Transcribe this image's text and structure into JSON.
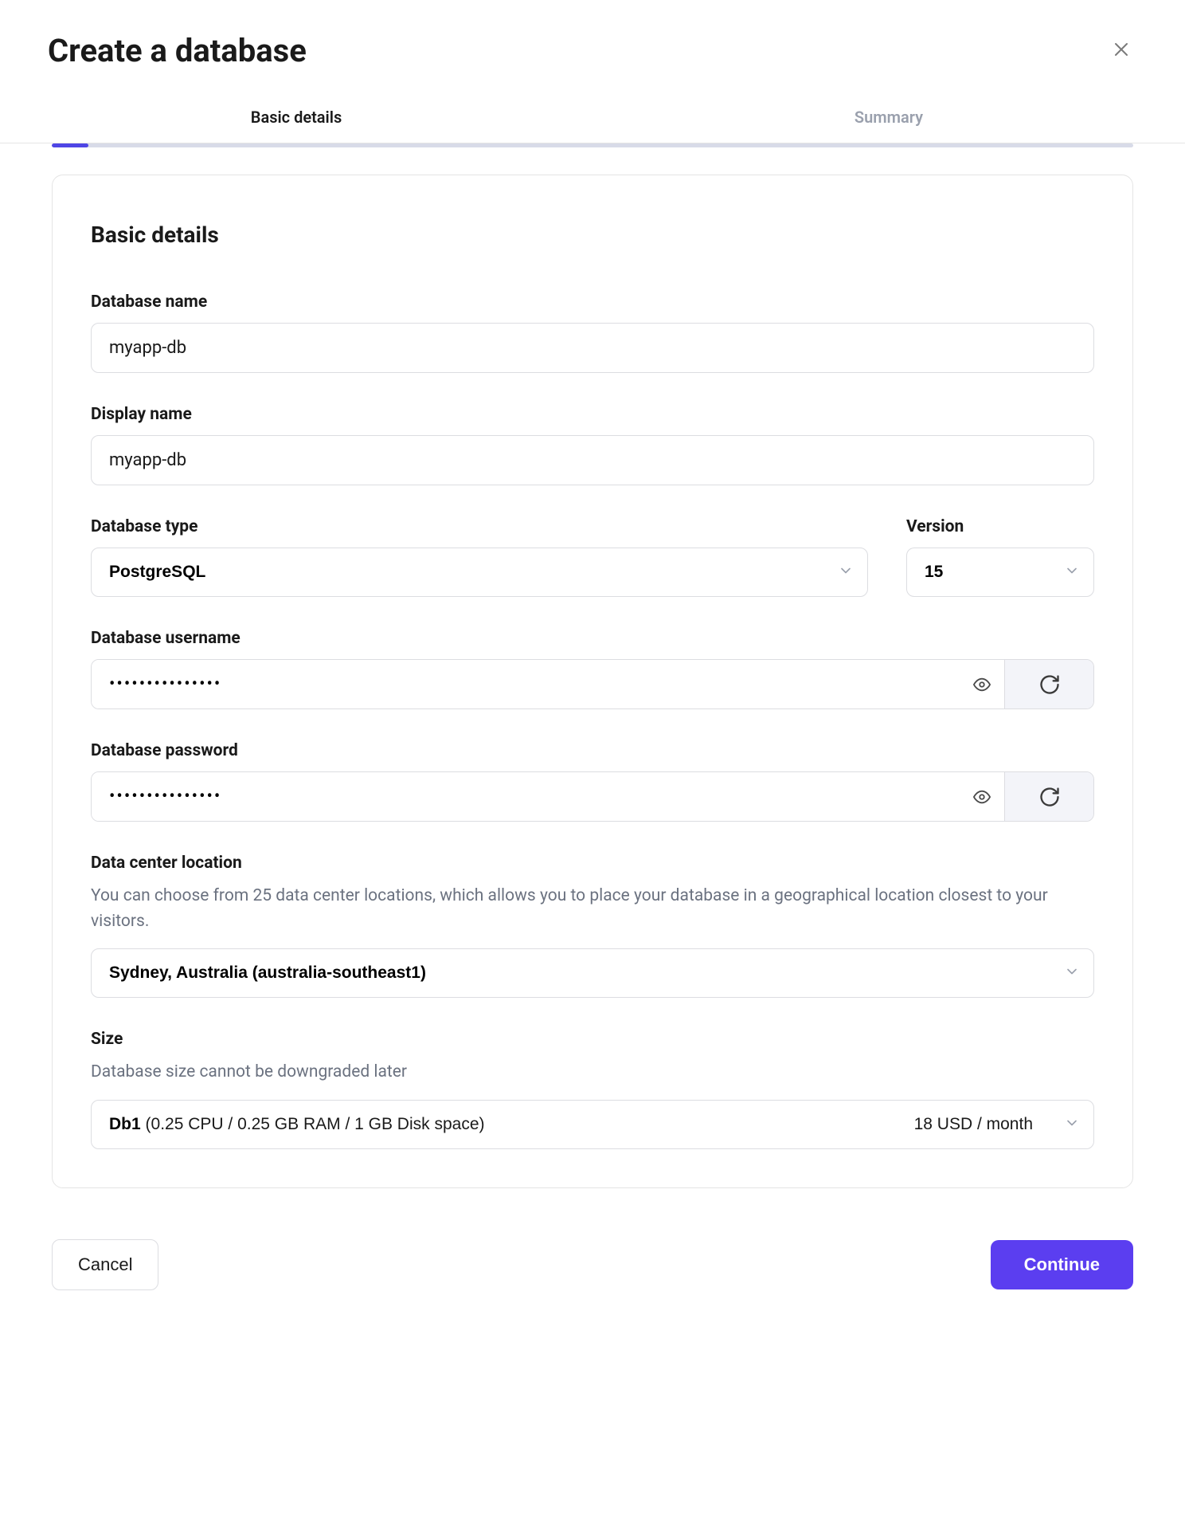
{
  "header": {
    "title": "Create a database"
  },
  "tabs": {
    "basic": "Basic details",
    "summary": "Summary"
  },
  "section": {
    "title": "Basic details"
  },
  "fields": {
    "db_name": {
      "label": "Database name",
      "value": "myapp-db"
    },
    "display_name": {
      "label": "Display name",
      "value": "myapp-db"
    },
    "db_type": {
      "label": "Database type",
      "value": "PostgreSQL"
    },
    "version": {
      "label": "Version",
      "value": "15"
    },
    "db_username": {
      "label": "Database username",
      "masked": "•••••••••••••••"
    },
    "db_password": {
      "label": "Database password",
      "masked": "•••••••••••••••"
    },
    "location": {
      "label": "Data center location",
      "description": "You can choose from 25 data center locations, which allows you to place your database in a geographical location closest to your visitors.",
      "value": "Sydney, Australia (australia-southeast1)"
    },
    "size": {
      "label": "Size",
      "description": "Database size cannot be downgraded later",
      "tier": "Db1",
      "spec": " (0.25 CPU / 0.25 GB RAM / 1 GB Disk space)",
      "price": "18 USD / month"
    }
  },
  "footer": {
    "cancel": "Cancel",
    "continue": "Continue"
  }
}
